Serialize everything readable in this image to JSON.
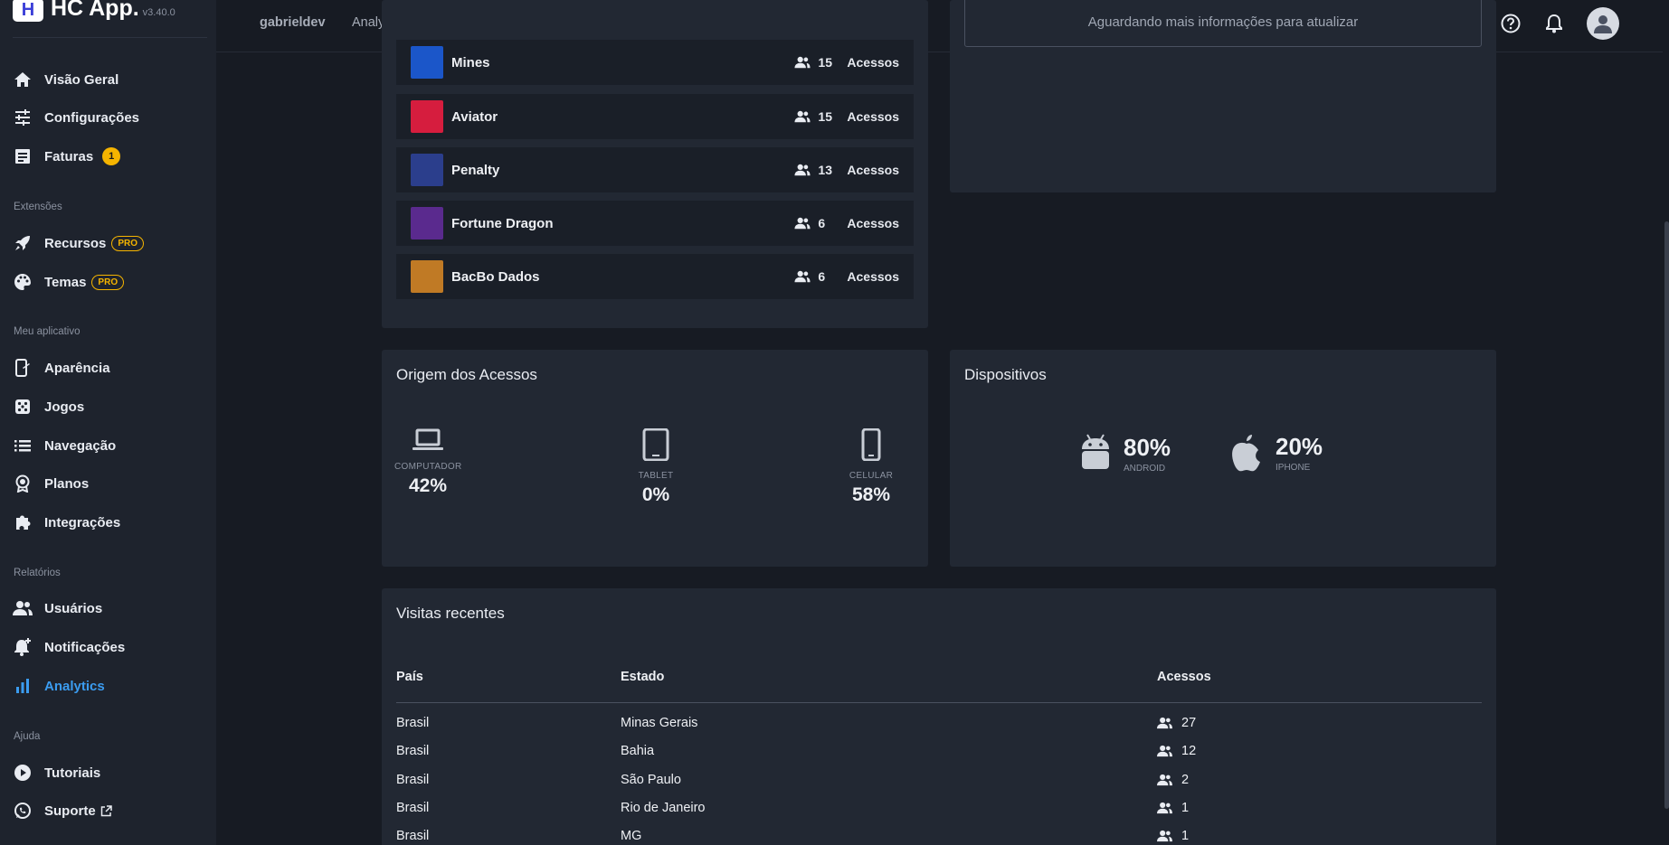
{
  "brand": {
    "logo_letter": "H",
    "name": "HC App.",
    "version": "v3.40.0"
  },
  "sidebar": {
    "main": [
      {
        "label": "Visão Geral",
        "icon": "home-icon"
      },
      {
        "label": "Configurações",
        "icon": "sliders-icon"
      },
      {
        "label": "Faturas",
        "icon": "receipt-icon",
        "badge": "1"
      }
    ],
    "section_extensions": "Extensões",
    "extensions": [
      {
        "label": "Recursos",
        "icon": "rocket-icon",
        "tag": "PRO"
      },
      {
        "label": "Temas",
        "icon": "palette-icon",
        "tag": "PRO"
      }
    ],
    "section_app": "Meu aplicativo",
    "app": [
      {
        "label": "Aparência",
        "icon": "phone-edit-icon"
      },
      {
        "label": "Jogos",
        "icon": "dice-icon"
      },
      {
        "label": "Navegação",
        "icon": "list-icon"
      },
      {
        "label": "Planos",
        "icon": "award-icon"
      },
      {
        "label": "Integrações",
        "icon": "puzzle-icon"
      }
    ],
    "section_reports": "Relatórios",
    "reports": [
      {
        "label": "Usuários",
        "icon": "users-icon"
      },
      {
        "label": "Notificações",
        "icon": "bell-plus-icon"
      },
      {
        "label": "Analytics",
        "icon": "bar-chart-icon",
        "active": true
      }
    ],
    "section_help": "Ajuda",
    "help": [
      {
        "label": "Tutoriais",
        "icon": "play-circle-icon"
      },
      {
        "label": "Suporte",
        "icon": "whatsapp-icon",
        "external": true
      }
    ]
  },
  "topbar": {
    "crumb_user": "gabrieldev",
    "crumb_page": "Analytics"
  },
  "games": [
    {
      "name": "Mines",
      "count": "15",
      "unit": "Acessos",
      "color": "#1b56c9"
    },
    {
      "name": "Aviator",
      "count": "15",
      "unit": "Acessos",
      "color": "#d61d3e"
    },
    {
      "name": "Penalty",
      "count": "13",
      "unit": "Acessos",
      "color": "#2b3e8c"
    },
    {
      "name": "Fortune Dragon",
      "count": "6",
      "unit": "Acessos",
      "color": "#5a2a8e"
    },
    {
      "name": "BacBo Dados",
      "count": "6",
      "unit": "Acessos",
      "color": "#c07a25"
    }
  ],
  "info_box": {
    "text": "Aguardando mais informações para atualizar"
  },
  "origin": {
    "title": "Origem dos Acessos",
    "items": [
      {
        "label": "COMPUTADOR",
        "value": "42%"
      },
      {
        "label": "TABLET",
        "value": "0%"
      },
      {
        "label": "CELULAR",
        "value": "58%"
      }
    ]
  },
  "devices": {
    "title": "Dispositivos",
    "items": [
      {
        "label": "ANDROID",
        "value": "80%"
      },
      {
        "label": "IPHONE",
        "value": "20%"
      }
    ]
  },
  "recent": {
    "title": "Visitas recentes",
    "headers": {
      "country": "País",
      "state": "Estado",
      "access": "Acessos"
    },
    "rows": [
      {
        "country": "Brasil",
        "state": "Minas Gerais",
        "access": "27"
      },
      {
        "country": "Brasil",
        "state": "Bahia",
        "access": "12"
      },
      {
        "country": "Brasil",
        "state": "São Paulo",
        "access": "2"
      },
      {
        "country": "Brasil",
        "state": "Rio de Janeiro",
        "access": "1"
      },
      {
        "country": "Brasil",
        "state": "MG",
        "access": "1"
      }
    ]
  },
  "colors": {
    "accent": "#3b9cf0",
    "badge": "#f5b400",
    "card": "#222833",
    "background": "#171b23"
  }
}
